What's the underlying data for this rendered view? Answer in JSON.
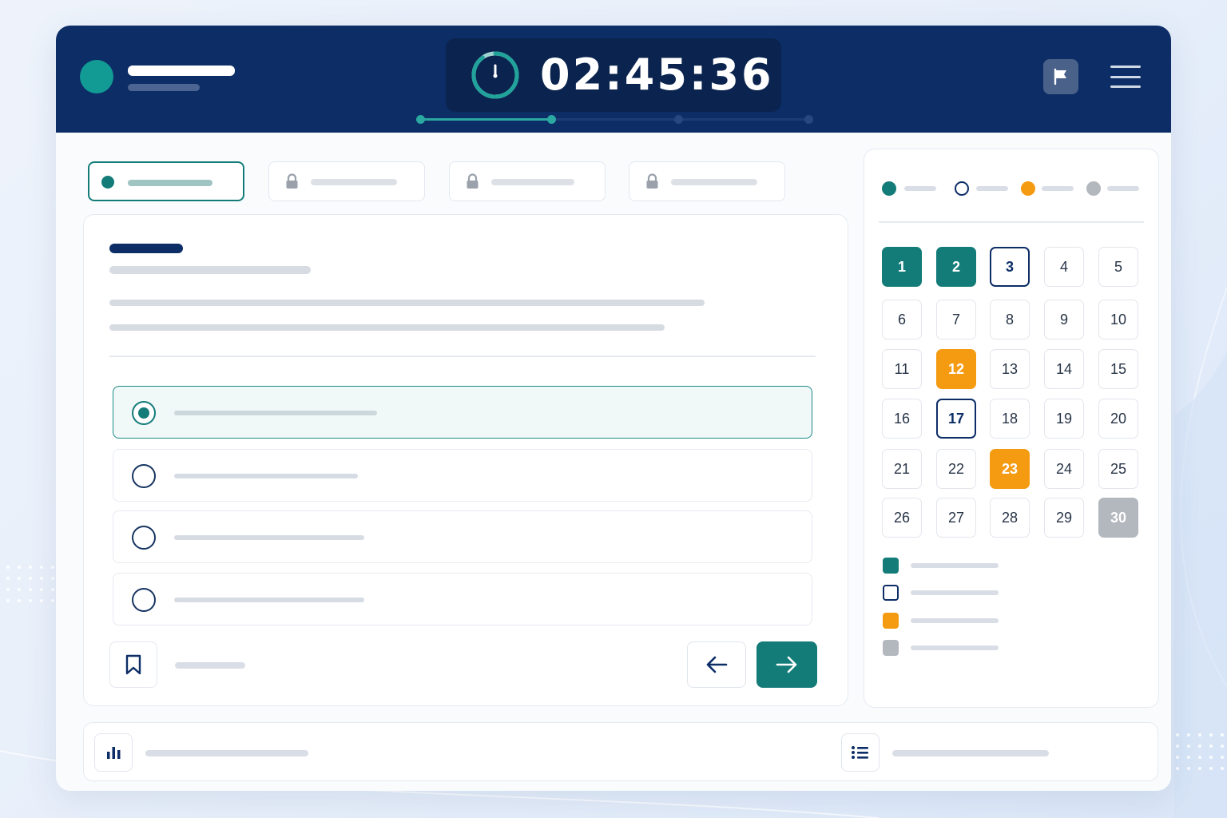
{
  "header": {
    "timer": "02:45:36",
    "timer_progress": 0.9,
    "section_progress": 0.34
  },
  "tabs": [
    {
      "state": "active"
    },
    {
      "state": "locked",
      "icon": "lock-icon"
    },
    {
      "state": "locked",
      "icon": "lock-icon"
    },
    {
      "state": "locked",
      "icon": "lock-icon"
    }
  ],
  "options": [
    {
      "selected": true
    },
    {
      "selected": false
    },
    {
      "selected": false
    },
    {
      "selected": false
    }
  ],
  "navigator": {
    "questions": [
      {
        "label": "1",
        "status": "answered"
      },
      {
        "label": "2",
        "status": "answered"
      },
      {
        "label": "3",
        "status": "current"
      },
      {
        "label": "4",
        "status": "unanswered"
      },
      {
        "label": "5",
        "status": "unanswered"
      },
      {
        "label": "6",
        "status": "unanswered"
      },
      {
        "label": "7",
        "status": "unanswered"
      },
      {
        "label": "8",
        "status": "unanswered"
      },
      {
        "label": "9",
        "status": "unanswered"
      },
      {
        "label": "10",
        "status": "unanswered"
      },
      {
        "label": "11",
        "status": "unanswered"
      },
      {
        "label": "12",
        "status": "flagged"
      },
      {
        "label": "13",
        "status": "unanswered"
      },
      {
        "label": "14",
        "status": "unanswered"
      },
      {
        "label": "15",
        "status": "unanswered"
      },
      {
        "label": "16",
        "status": "unanswered"
      },
      {
        "label": "17",
        "status": "current"
      },
      {
        "label": "18",
        "status": "unanswered"
      },
      {
        "label": "19",
        "status": "unanswered"
      },
      {
        "label": "20",
        "status": "unanswered"
      },
      {
        "label": "21",
        "status": "unanswered"
      },
      {
        "label": "22",
        "status": "unanswered"
      },
      {
        "label": "23",
        "status": "flagged"
      },
      {
        "label": "24",
        "status": "unanswered"
      },
      {
        "label": "25",
        "status": "unanswered"
      },
      {
        "label": "26",
        "status": "unanswered"
      },
      {
        "label": "27",
        "status": "unanswered"
      },
      {
        "label": "28",
        "status": "unanswered"
      },
      {
        "label": "29",
        "status": "unanswered"
      },
      {
        "label": "30",
        "status": "skipped"
      }
    ]
  },
  "icons": {
    "flag": "flag-icon",
    "menu": "hamburger-menu-icon",
    "bookmark": "bookmark-icon",
    "prev": "arrow-left-icon",
    "next": "arrow-right-icon",
    "stats": "bar-chart-icon",
    "list": "list-icon"
  },
  "colors": {
    "header_bg": "#0c2d66",
    "teal_accent": "#137c79",
    "flagged": "#f59b12",
    "skipped": "#b3b7be"
  }
}
